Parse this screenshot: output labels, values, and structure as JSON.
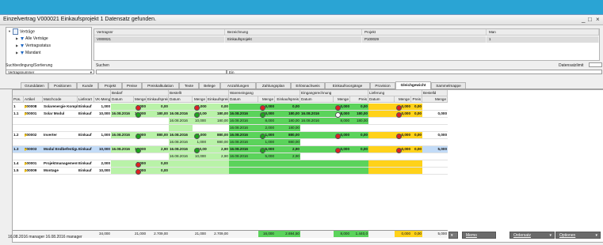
{
  "window": {
    "title": "Einzelvertrag V000021 Einkaufsprojekt  1 Datensatz gefunden."
  },
  "tree": {
    "items": [
      {
        "label": "Verträge"
      },
      {
        "label": "Alle Verträge"
      },
      {
        "label": "Vertragsstatus"
      },
      {
        "label": "Mandant"
      }
    ]
  },
  "info": {
    "headers": [
      "Vertragsnr",
      "Bezeichnung",
      "Projekt",
      "Man"
    ],
    "values": [
      "V000021",
      "Einkaufsprojekt",
      "P100029",
      "1"
    ]
  },
  "search": {
    "sort_label": "Suchbedingung/Sortierung",
    "search_label": "Suchen",
    "limit_label": "Datensatzlimit",
    "sort_value": "Vertragsnummer",
    "mode_value": "Ein"
  },
  "tabs": [
    "Grunddaten",
    "Positionen",
    "Kunde",
    "Projekt",
    "Preise",
    "Preiskalkulation",
    "Texte",
    "Belege",
    "Anzahlungen",
    "Zahlungsplan",
    "Erlösnachweis",
    "Einkaufsvorgänge",
    "Provision",
    "Gleichgewicht",
    "Sammelmappe"
  ],
  "active_tab": "Gleichgewicht",
  "grid": {
    "group_headers": [
      "Bedarf",
      "Bestellt",
      "Wareneingang",
      "Eingangsrechnung",
      "Lieferung",
      "Bestelld"
    ],
    "columns": [
      "Pos.",
      "Artikel",
      "Matchcode",
      "Lieferart",
      "VK-Menge",
      "Datum",
      "Menge",
      "Einkaufspreis",
      "Datum",
      "Menge",
      "Einkaufspreis",
      "Datum",
      "Menge",
      "Einkaufspreis",
      "Datum",
      "Menge",
      "Preis",
      "Datum",
      "Menge",
      "Preis",
      "Menge"
    ],
    "rows": [
      {
        "pos": "1",
        "artikel": "200008",
        "matchcode": "Solarenergie Komplettanlage",
        "lieferart": "Einkauf",
        "vk": "1,000",
        "bd_datum": "",
        "bd_menge": "0,000",
        "bd_ek": "0,00",
        "be_datum": "",
        "be_menge": "0,000",
        "be_ek": "0,00",
        "we_datum": "",
        "we_menge": "0,000",
        "we_ek": "0,00",
        "er_datum": "",
        "er_menge": "0,000",
        "er_preis": "0,00",
        "li_datum": "",
        "li_menge": "0,000",
        "li_preis": "0,00",
        "bl_menge": ""
      },
      {
        "pos": "1.1",
        "artikel": "200001",
        "matchcode": "Solar Modul",
        "lieferart": "Einkauf",
        "vk": "10,000",
        "bd_datum": "16.08.2016",
        "bd_menge": "10,000",
        "bd_ek": "180,00",
        "be_datum": "16.08.2016",
        "be_menge": "10,000",
        "be_ek": "180,00",
        "we_datum": "16.08.2016",
        "we_menge": "10,000",
        "we_ek": "180,00",
        "er_datum": "16.08.2016",
        "er_menge": "8,000",
        "er_preis": "180,00",
        "li_datum": "",
        "li_menge": "0,000",
        "li_preis": "0,00",
        "bl_menge": "0,000"
      },
      {
        "pos": "",
        "artikel": "",
        "matchcode": "",
        "lieferart": "",
        "vk": "",
        "bd_datum": "",
        "bd_menge": "",
        "bd_ek": "",
        "be_datum": "16.08.2016",
        "be_menge": "10,000",
        "be_ek": "180,00",
        "we_datum": "16.08.2016",
        "we_menge": "8,000",
        "we_ek": "180,00",
        "er_datum": "16.08.2016",
        "er_menge": "8,000",
        "er_preis": "180,00",
        "li_datum": "",
        "li_menge": "",
        "li_preis": "",
        "bl_menge": ""
      },
      {
        "pos": "",
        "artikel": "",
        "matchcode": "",
        "lieferart": "",
        "vk": "",
        "bd_datum": "",
        "bd_menge": "",
        "bd_ek": "",
        "be_datum": "",
        "be_menge": "",
        "be_ek": "",
        "we_datum": "16.08.2016",
        "we_menge": "2,000",
        "we_ek": "180,00",
        "er_datum": "",
        "er_menge": "",
        "er_preis": "",
        "li_datum": "",
        "li_menge": "",
        "li_preis": "",
        "bl_menge": ""
      },
      {
        "pos": "1.2",
        "artikel": "200002",
        "matchcode": "Inverter",
        "lieferart": "Einkauf",
        "vk": "1,000",
        "bd_datum": "16.08.2016",
        "bd_menge": "1,000",
        "bd_ek": "880,00",
        "be_datum": "16.08.2016",
        "be_menge": "1,000",
        "be_ek": "880,00",
        "we_datum": "16.08.2016",
        "we_menge": "1,000",
        "we_ek": "880,00",
        "er_datum": "",
        "er_menge": "0,000",
        "er_preis": "0,00",
        "li_datum": "",
        "li_menge": "0,000",
        "li_preis": "0,00",
        "bl_menge": "0,000"
      },
      {
        "pos": "",
        "artikel": "",
        "matchcode": "",
        "lieferart": "",
        "vk": "",
        "bd_datum": "",
        "bd_menge": "",
        "bd_ek": "",
        "be_datum": "16.08.2016",
        "be_menge": "1,000",
        "be_ek": "880,00",
        "we_datum": "16.08.2016",
        "we_menge": "1,000",
        "we_ek": "880,00",
        "er_datum": "",
        "er_menge": "",
        "er_preis": "",
        "li_datum": "",
        "li_menge": "",
        "li_preis": "",
        "bl_menge": ""
      },
      {
        "pos": "1.3",
        "artikel": "200003",
        "matchcode": "Modul Endbefestigungen",
        "lieferart": "Einkauf",
        "vk": "10,000",
        "bd_datum": "16.08.2016",
        "bd_menge": "10,000",
        "bd_ek": "2,90",
        "be_datum": "16.08.2016",
        "be_menge": "10,000",
        "be_ek": "2,90",
        "we_datum": "16.08.2016",
        "we_menge": "5,000",
        "we_ek": "2,90",
        "er_datum": "",
        "er_menge": "0,000",
        "er_preis": "0,00",
        "li_datum": "",
        "li_menge": "0,000",
        "li_preis": "0,00",
        "bl_menge": "5,000"
      },
      {
        "pos": "",
        "artikel": "",
        "matchcode": "",
        "lieferart": "",
        "vk": "",
        "bd_datum": "",
        "bd_menge": "",
        "bd_ek": "",
        "be_datum": "16.08.2016",
        "be_menge": "10,000",
        "be_ek": "2,90",
        "we_datum": "16.08.2016",
        "we_menge": "5,000",
        "we_ek": "2,90",
        "er_datum": "",
        "er_menge": "",
        "er_preis": "",
        "li_datum": "",
        "li_menge": "",
        "li_preis": "",
        "bl_menge": ""
      },
      {
        "pos": "1.4",
        "artikel": "100001",
        "matchcode": "Projektmanagement",
        "lieferart": "Einkauf",
        "vk": "2,000",
        "bd_datum": "",
        "bd_menge": "0,000",
        "bd_ek": "0,00",
        "be_datum": "",
        "be_menge": "",
        "be_ek": "",
        "we_datum": "",
        "we_menge": "",
        "we_ek": "",
        "er_datum": "",
        "er_menge": "",
        "er_preis": "",
        "li_datum": "",
        "li_menge": "",
        "li_preis": "",
        "bl_menge": ""
      },
      {
        "pos": "1.5",
        "artikel": "100009",
        "matchcode": "Montage",
        "lieferart": "Einkauf",
        "vk": "10,000",
        "bd_datum": "",
        "bd_menge": "0,000",
        "bd_ek": "0,00",
        "be_datum": "",
        "be_menge": "",
        "be_ek": "",
        "we_datum": "",
        "we_menge": "",
        "we_ek": "",
        "er_datum": "",
        "er_menge": "",
        "er_preis": "",
        "li_datum": "",
        "li_menge": "",
        "li_preis": "",
        "bl_menge": ""
      }
    ],
    "totals": {
      "vk": "34,000",
      "bd_menge": "21,000",
      "bd_ek": "2.709,00",
      "be_menge": "21,000",
      "be_ek": "2.709,00",
      "we_menge": "16,000",
      "we_ek": "2.694,50",
      "er_menge": "8,000",
      "er_preis": "1.440,0",
      "li_menge": "0,000",
      "li_preis": "0,00",
      "bl_menge": "5,000"
    }
  },
  "status": {
    "text": "16.08.2016 manager  16.08.2016 manager"
  },
  "buttons": {
    "memo": "Memo",
    "ordersatz": "Ordersatz",
    "optionen": "Optionen"
  },
  "colors": {
    "green": "#5bd35b",
    "light_green": "#b9f2a8",
    "yellow": "#ffd21a",
    "selected": "#c2dbf7",
    "red": "#e02020"
  }
}
